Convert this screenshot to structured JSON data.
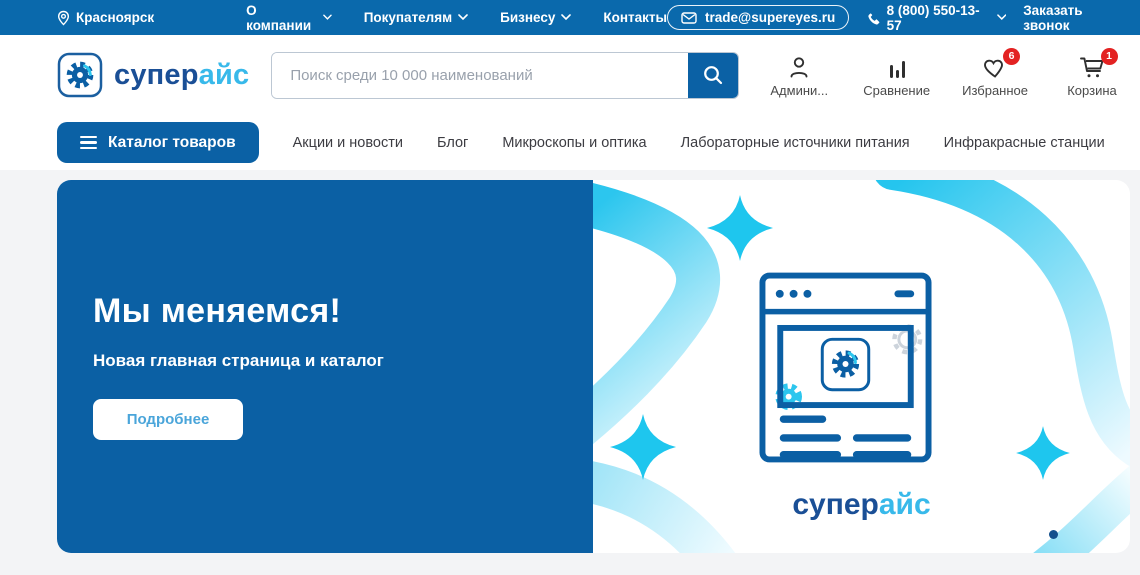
{
  "topbar": {
    "city": "Красноярск",
    "menu": [
      {
        "label": "О компании"
      },
      {
        "label": "Покупателям"
      },
      {
        "label": "Бизнесу"
      },
      {
        "label": "Контакты"
      }
    ],
    "email": "trade@supereyes.ru",
    "phone": "8 (800) 550-13-57",
    "callback": "Заказать звонок"
  },
  "header": {
    "logo": {
      "part1": "супер",
      "part2": "айс"
    },
    "search": {
      "placeholder": "Поиск среди 10 000 наименований"
    },
    "actions": [
      {
        "label": "Админи..."
      },
      {
        "label": "Сравнение"
      },
      {
        "label": "Избранное",
        "badge": "6"
      },
      {
        "label": "Корзина",
        "badge": "1"
      }
    ]
  },
  "nav": {
    "catalog_button": "Каталог товаров",
    "links": [
      "Акции и новости",
      "Блог",
      "Микроскопы и оптика",
      "Лабораторные источники питания",
      "Инфракрасные станции"
    ]
  },
  "banner": {
    "title": "Мы меняемся!",
    "subtitle": "Новая главная страница и каталог",
    "button": "Подробнее",
    "brand_part1": "супер",
    "brand_part2": "айс"
  },
  "colors": {
    "topbar_bg": "#0a69ac",
    "primary_blue": "#0b61a5",
    "banner_blue": "#0b60a4",
    "logo_dark": "#1a4f96",
    "logo_cyan": "#38b9ea",
    "sparkle_cyan": "#1ec6ee",
    "badge_red": "#e32222",
    "page_bg": "#f3f4f6"
  }
}
